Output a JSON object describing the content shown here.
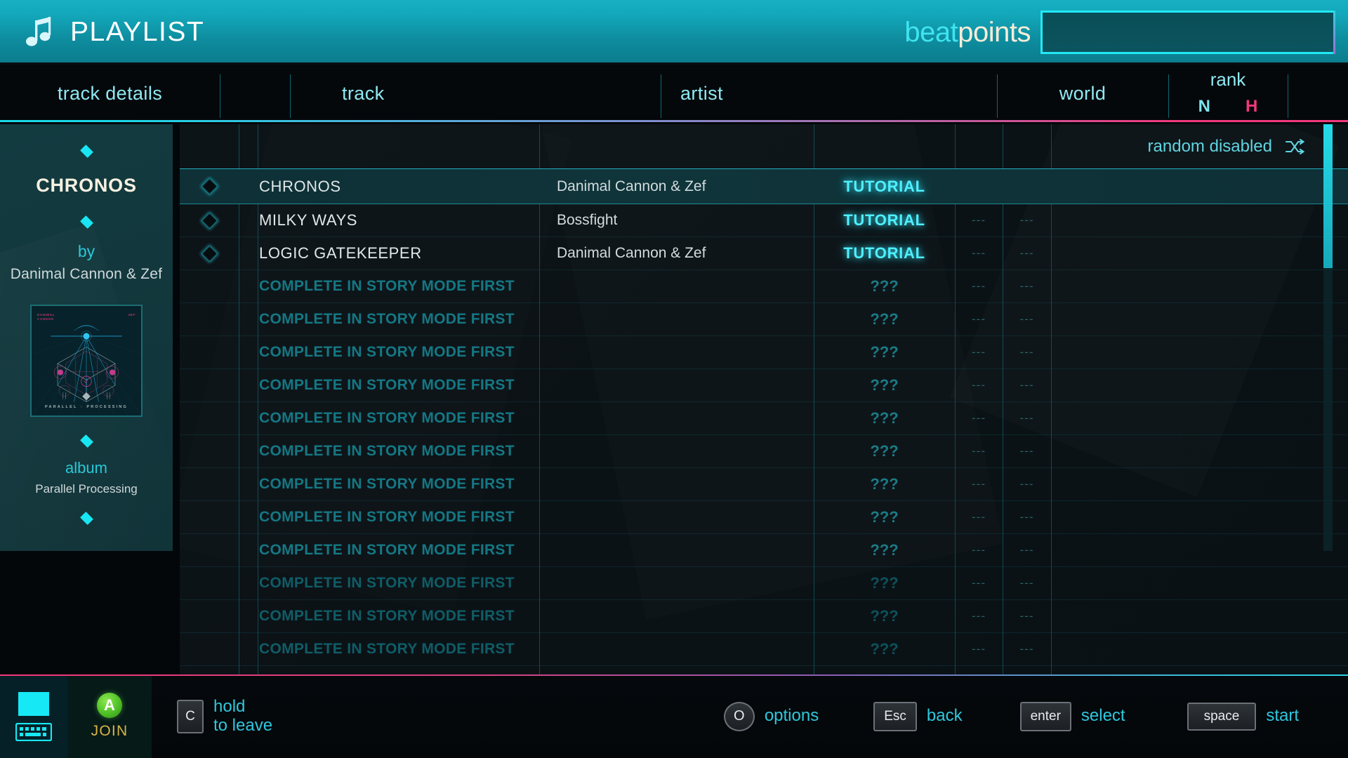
{
  "header": {
    "title": "PLAYLIST",
    "note_icon": "music-note-icon",
    "brand_part1": "beat",
    "brand_part2": "points",
    "search": {
      "value": "",
      "placeholder": ""
    }
  },
  "columns": {
    "details": "track details",
    "track": "track",
    "artist": "artist",
    "world": "world",
    "rank": "rank",
    "rank_n": "N",
    "rank_h": "H"
  },
  "sidebar": {
    "title": "CHRONOS",
    "by_label": "by",
    "artist": "Danimal Cannon & Zef",
    "album_label": "album",
    "album_name": "Parallel Processing",
    "album_art": {
      "left_label": "DANIMAL\nCANNON",
      "right_label": "ZEF",
      "bottom_label": "PARALLEL  PROCESSING"
    }
  },
  "list": {
    "random_label": "random disabled",
    "shuffle_icon": "shuffle-icon",
    "dash": "---",
    "rows": [
      {
        "marker": true,
        "track": "CHRONOS",
        "artist": "Danimal Cannon & Zef",
        "world": "TUTORIAL",
        "rank_n": "",
        "rank_h": "",
        "locked": false,
        "selected": true
      },
      {
        "marker": true,
        "track": "MILKY WAYS",
        "artist": "Bossfight",
        "world": "TUTORIAL",
        "rank_n": "---",
        "rank_h": "---",
        "locked": false,
        "selected": false
      },
      {
        "marker": true,
        "track": "LOGIC GATEKEEPER",
        "artist": "Danimal Cannon & Zef",
        "world": "TUTORIAL",
        "rank_n": "---",
        "rank_h": "---",
        "locked": false,
        "selected": false
      },
      {
        "marker": false,
        "track": "COMPLETE IN STORY MODE FIRST",
        "artist": "",
        "world": "???",
        "rank_n": "---",
        "rank_h": "---",
        "locked": true,
        "selected": false
      },
      {
        "marker": false,
        "track": "COMPLETE IN STORY MODE FIRST",
        "artist": "",
        "world": "???",
        "rank_n": "---",
        "rank_h": "---",
        "locked": true,
        "selected": false
      },
      {
        "marker": false,
        "track": "COMPLETE IN STORY MODE FIRST",
        "artist": "",
        "world": "???",
        "rank_n": "---",
        "rank_h": "---",
        "locked": true,
        "selected": false
      },
      {
        "marker": false,
        "track": "COMPLETE IN STORY MODE FIRST",
        "artist": "",
        "world": "???",
        "rank_n": "---",
        "rank_h": "---",
        "locked": true,
        "selected": false
      },
      {
        "marker": false,
        "track": "COMPLETE IN STORY MODE FIRST",
        "artist": "",
        "world": "???",
        "rank_n": "---",
        "rank_h": "---",
        "locked": true,
        "selected": false
      },
      {
        "marker": false,
        "track": "COMPLETE IN STORY MODE FIRST",
        "artist": "",
        "world": "???",
        "rank_n": "---",
        "rank_h": "---",
        "locked": true,
        "selected": false
      },
      {
        "marker": false,
        "track": "COMPLETE IN STORY MODE FIRST",
        "artist": "",
        "world": "???",
        "rank_n": "---",
        "rank_h": "---",
        "locked": true,
        "selected": false
      },
      {
        "marker": false,
        "track": "COMPLETE IN STORY MODE FIRST",
        "artist": "",
        "world": "???",
        "rank_n": "---",
        "rank_h": "---",
        "locked": true,
        "selected": false
      },
      {
        "marker": false,
        "track": "COMPLETE IN STORY MODE FIRST",
        "artist": "",
        "world": "???",
        "rank_n": "---",
        "rank_h": "---",
        "locked": true,
        "selected": false
      },
      {
        "marker": false,
        "track": "COMPLETE IN STORY MODE FIRST",
        "artist": "",
        "world": "???",
        "rank_n": "---",
        "rank_h": "---",
        "locked": true,
        "selected": false
      },
      {
        "marker": false,
        "track": "COMPLETE IN STORY MODE FIRST",
        "artist": "",
        "world": "???",
        "rank_n": "---",
        "rank_h": "---",
        "locked": true,
        "selected": false
      },
      {
        "marker": false,
        "track": "COMPLETE IN STORY MODE FIRST",
        "artist": "",
        "world": "???",
        "rank_n": "---",
        "rank_h": "---",
        "locked": true,
        "selected": false
      }
    ]
  },
  "bottom_bar": {
    "join_label": "JOIN",
    "join_button": "A",
    "keyboard_icon": "keyboard-icon",
    "leave_key": "C",
    "leave_line1": "hold",
    "leave_line2": "to leave",
    "options_key": "O",
    "options_label": "options",
    "back_key": "Esc",
    "back_label": "back",
    "select_key": "enter",
    "select_label": "select",
    "start_key": "space",
    "start_label": "start"
  },
  "colors": {
    "accent_cyan": "#22e9f5",
    "accent_pink": "#f2387c",
    "teal_panel": "#123b40",
    "gold": "#d8b447",
    "green": "#4fbf26"
  }
}
